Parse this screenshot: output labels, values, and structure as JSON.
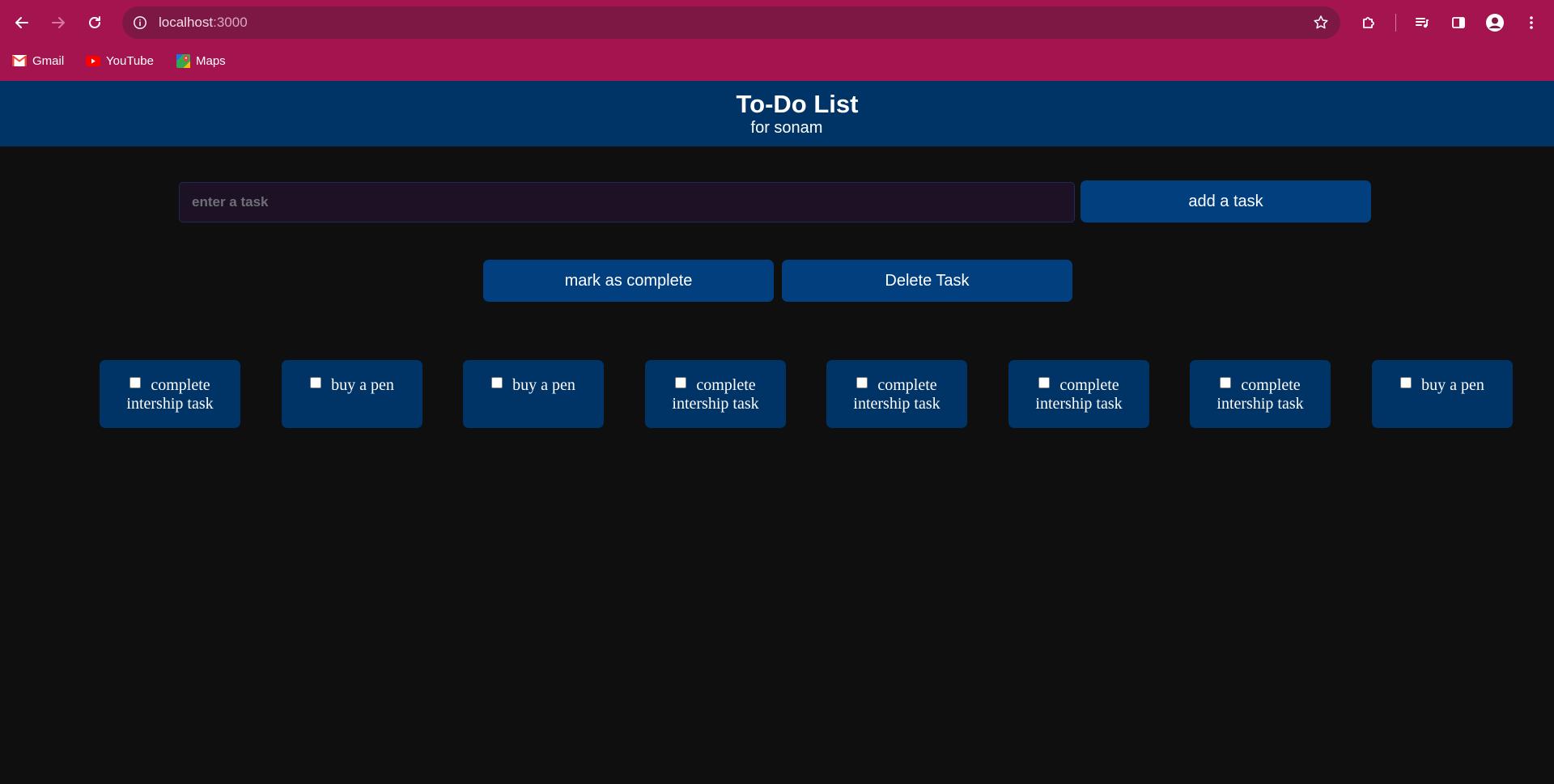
{
  "browser": {
    "url_host": "localhost",
    "url_port": ":3000",
    "bookmarks": [
      {
        "label": "Gmail",
        "icon": "gmail-icon"
      },
      {
        "label": "YouTube",
        "icon": "youtube-icon"
      },
      {
        "label": "Maps",
        "icon": "maps-icon"
      }
    ]
  },
  "header": {
    "title": "To-Do List",
    "subtitle": "for sonam"
  },
  "input": {
    "placeholder": "enter a task",
    "value": ""
  },
  "buttons": {
    "add": "add a task",
    "complete": "mark as complete",
    "delete": "Delete Task"
  },
  "tasks": [
    {
      "text": "complete intership task",
      "checked": false
    },
    {
      "text": "buy a pen",
      "checked": false
    },
    {
      "text": "buy a pen",
      "checked": false
    },
    {
      "text": "complete intership task",
      "checked": false
    },
    {
      "text": "complete intership task",
      "checked": false
    },
    {
      "text": "complete intership task",
      "checked": false
    },
    {
      "text": "complete intership task",
      "checked": false
    },
    {
      "text": "buy a pen",
      "checked": false
    }
  ],
  "colors": {
    "chrome": "#a4154f",
    "header": "#003366",
    "button": "#013f7f",
    "background": "#0f0f0f"
  }
}
